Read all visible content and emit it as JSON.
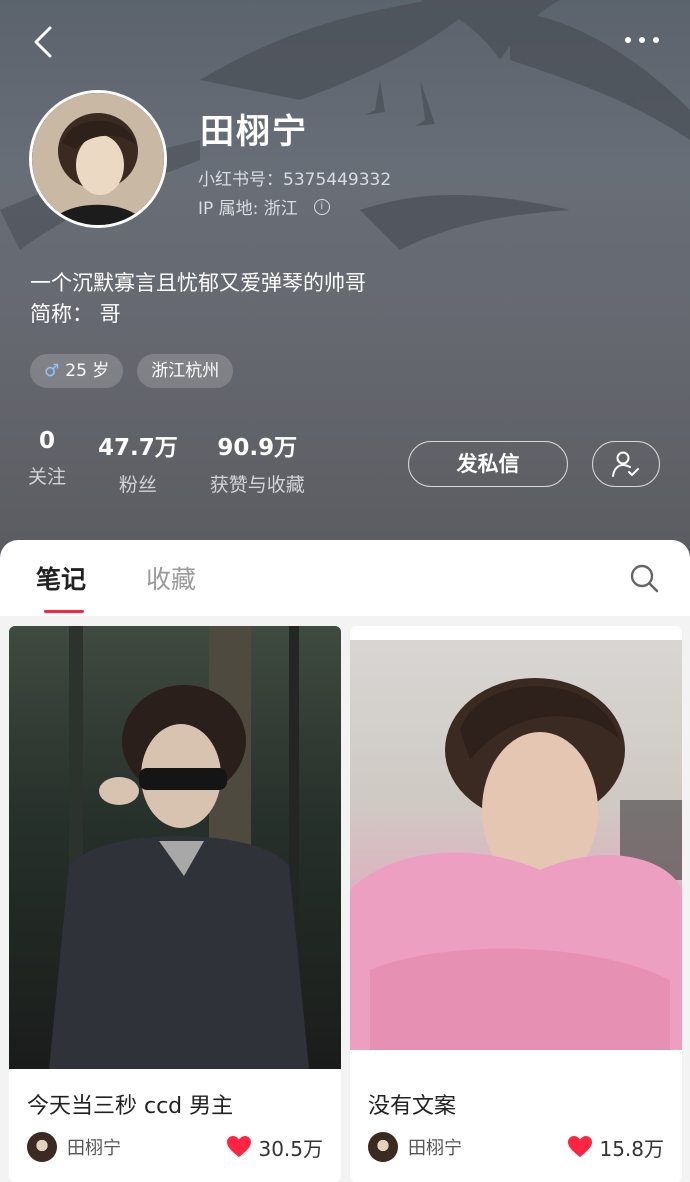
{
  "profile": {
    "name": "田栩宁",
    "xhs_id": "小红书号：5375449332",
    "ip_location": "IP 属地: 浙江",
    "bio_line1": "一个沉默寡言且忧郁又爱弹琴的帅哥",
    "bio_line2": "简称：  哥",
    "tag_age": "25 岁",
    "tag_city": "浙江杭州"
  },
  "stats": [
    {
      "value": "0",
      "label": "关注"
    },
    {
      "value": "47.7万",
      "label": "粉丝"
    },
    {
      "value": "90.9万",
      "label": "获赞与收藏"
    }
  ],
  "actions": {
    "message_label": "发私信"
  },
  "tabs": [
    {
      "label": "笔记",
      "active": true
    },
    {
      "label": "收藏",
      "active": false
    }
  ],
  "notes": [
    {
      "title": "今天当三秒 ccd 男主",
      "author": "田栩宁",
      "likes": "30.5万"
    },
    {
      "title": "没有文案",
      "author": "田栩宁",
      "likes": "15.8万"
    }
  ],
  "colors": {
    "accent": "#ff2442",
    "header_bg": "#646a72"
  },
  "icons": {
    "back": "chevron-left-icon",
    "more": "more-dots-icon",
    "info": "info-icon",
    "gender": "male-icon",
    "follow": "user-check-icon",
    "search": "search-icon",
    "like": "heart-icon"
  }
}
